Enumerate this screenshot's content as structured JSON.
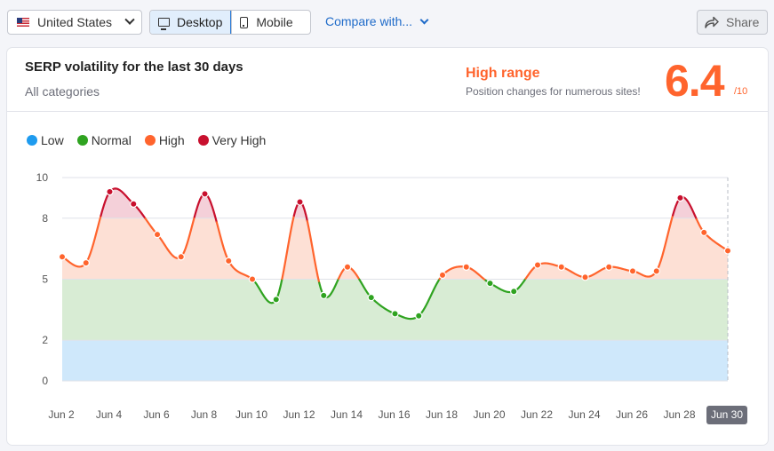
{
  "toolbar": {
    "country": "United States",
    "desktop_label": "Desktop",
    "mobile_label": "Mobile",
    "compare_label": "Compare with...",
    "share_label": "Share"
  },
  "card": {
    "title": "SERP volatility for the last 30 days",
    "subtitle": "All categories",
    "range_label": "High range",
    "range_desc": "Position changes for numerous sites!",
    "score": "6.4",
    "score_max": "/10"
  },
  "legend": [
    {
      "label": "Low",
      "color": "#1e9bef"
    },
    {
      "label": "Normal",
      "color": "#2fa320"
    },
    {
      "label": "High",
      "color": "#ff642d"
    },
    {
      "label": "Very High",
      "color": "#c8102e"
    }
  ],
  "chart_data": {
    "type": "area",
    "title": "SERP volatility for the last 30 days",
    "y_ticks": [
      0,
      2,
      5,
      8,
      10
    ],
    "ylim": [
      0,
      10
    ],
    "bands": [
      {
        "name": "Low",
        "from": 0,
        "to": 2,
        "color": "#cfe8fb",
        "line": "#1e9bef"
      },
      {
        "name": "Normal",
        "from": 2,
        "to": 5,
        "color": "#d8ecd4",
        "line": "#2fa320"
      },
      {
        "name": "High",
        "from": 5,
        "to": 8,
        "color": "#fde0d5",
        "line": "#ff642d"
      },
      {
        "name": "Very High",
        "from": 8,
        "to": 10,
        "color": "#f4d0d9",
        "line": "#c8102e"
      }
    ],
    "x_labels": [
      "Jun 2",
      "Jun 4",
      "Jun 6",
      "Jun 8",
      "Jun 10",
      "Jun 12",
      "Jun 14",
      "Jun 16",
      "Jun 18",
      "Jun 20",
      "Jun 22",
      "Jun 24",
      "Jun 26",
      "Jun 28",
      "Jun 30"
    ],
    "highlight_label": "Jun 30",
    "days": [
      2,
      3,
      4,
      5,
      6,
      7,
      8,
      9,
      10,
      11,
      12,
      13,
      14,
      15,
      16,
      17,
      18,
      19,
      20,
      21,
      22,
      23,
      24,
      25,
      26,
      27,
      28,
      29,
      30
    ],
    "values": [
      6.1,
      5.8,
      9.3,
      8.7,
      7.2,
      6.1,
      9.2,
      5.9,
      5.0,
      4.0,
      8.8,
      4.2,
      5.6,
      4.1,
      3.3,
      3.2,
      5.2,
      5.6,
      4.8,
      4.4,
      5.7,
      5.6,
      5.1,
      5.6,
      5.4,
      5.4,
      9.0,
      7.3,
      6.4
    ]
  }
}
